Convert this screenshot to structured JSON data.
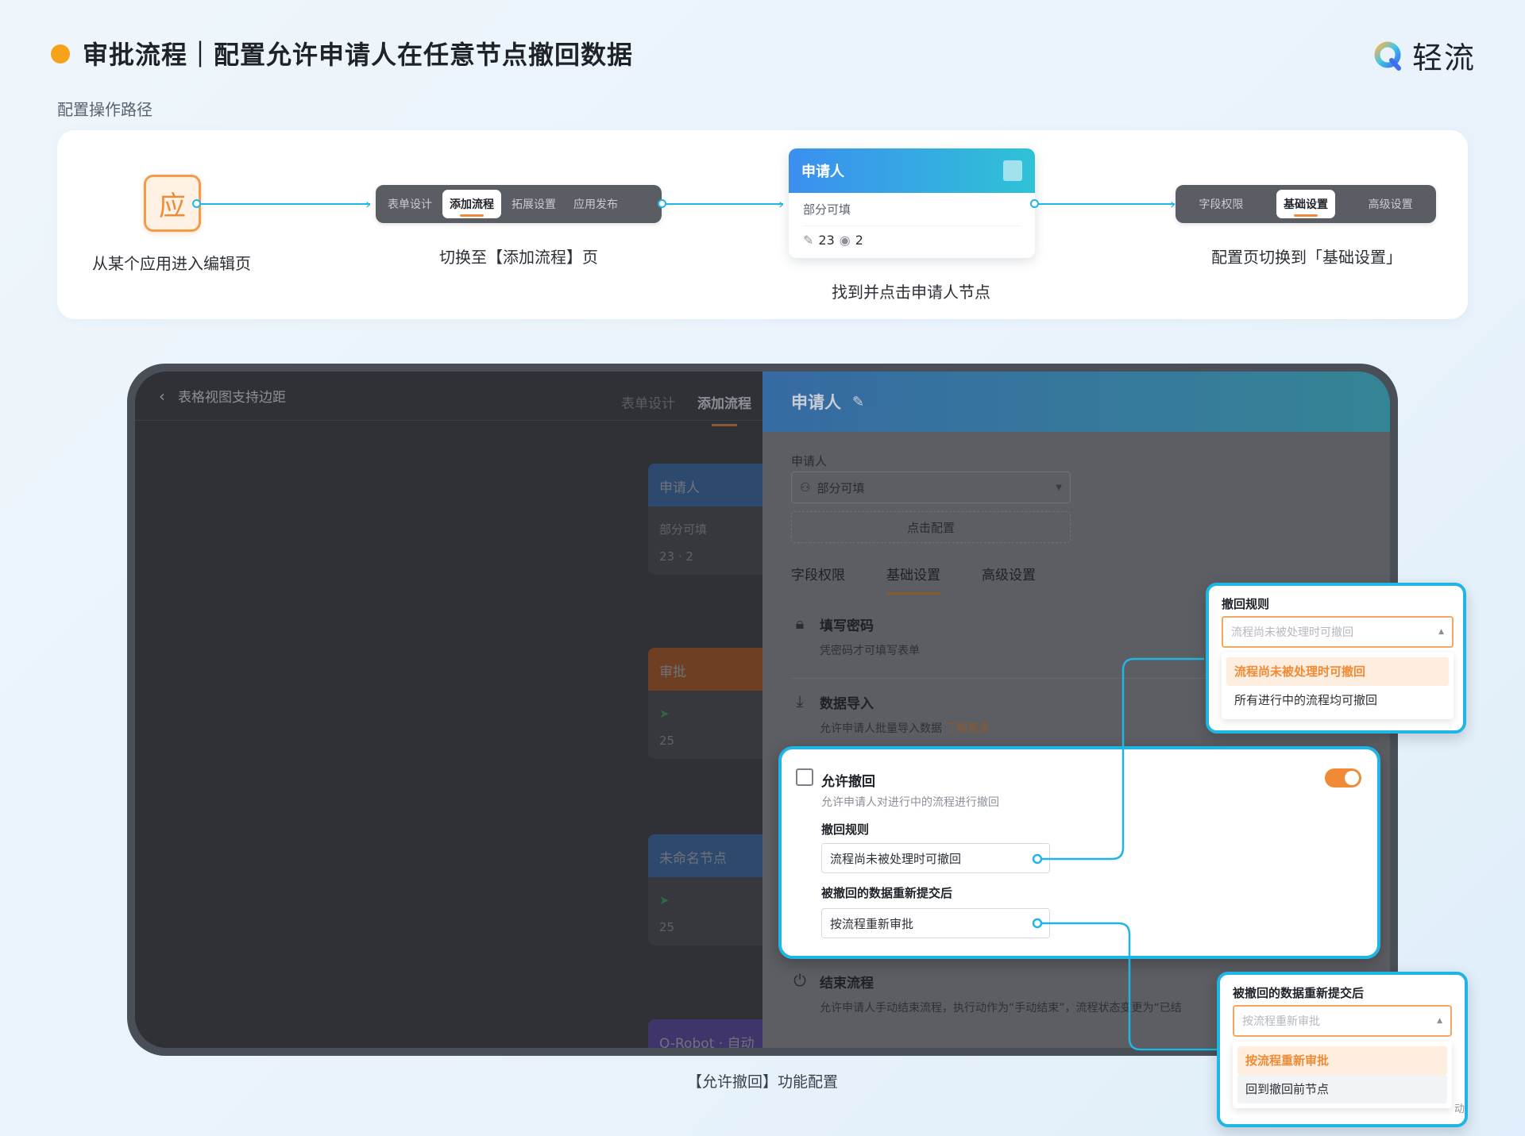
{
  "header": {
    "title": "审批流程｜配置允许申请人在任意节点撤回数据",
    "brand_name": "轻流",
    "path_label": "配置操作路径"
  },
  "steps": {
    "app_icon_char": "应",
    "step1_caption": "从某个应用进入编辑页",
    "step2_tabs": [
      "表单设计",
      "添加流程",
      "拓展设置",
      "应用发布"
    ],
    "step2_caption": "切换至【添加流程】页",
    "step3_node_title": "申请人",
    "step3_node_sub": "部分可填",
    "step3_edit_count": "23",
    "step3_view_count": "2",
    "step3_caption": "找到并点击申请人节点",
    "step4_tabs": [
      "字段权限",
      "基础设置",
      "高级设置"
    ],
    "step4_caption": "配置页切换到「基础设置」"
  },
  "editor": {
    "back_title": "表格视图支持边距",
    "top_tabs": [
      "表单设计",
      "添加流程"
    ],
    "nodes": [
      {
        "title": "申请人",
        "sub": "部分可填",
        "stats": "23 · 2"
      },
      {
        "title": "审批",
        "sub": "",
        "stats": "25"
      },
      {
        "title": "未命名节点",
        "sub": "",
        "stats": "25"
      },
      {
        "title": "Q-Robot · 自动流",
        "sub": "",
        "stats": ""
      }
    ]
  },
  "panel": {
    "title": "申请人",
    "field_label": "申请人",
    "select_value": "部分可填",
    "config_button": "点击配置",
    "tabs": [
      "字段权限",
      "基础设置",
      "高级设置"
    ],
    "items": [
      {
        "title": "填写密码",
        "desc": "凭密码才可填写表单"
      },
      {
        "title": "数据导入",
        "desc": "允许申请人批量导入数据",
        "link": "了解更多"
      },
      {
        "title": "结束流程",
        "desc": "允许申请人手动结束流程，执行动作为“手动结束”，流程状态变更为“已结"
      }
    ]
  },
  "withdraw": {
    "title": "允许撤回",
    "desc": "允许申请人对进行中的流程进行撤回",
    "rule_label": "撤回规则",
    "rule_value": "流程尚未被处理时可撤回",
    "resubmit_label": "被撤回的数据重新提交后",
    "resubmit_value": "按流程重新审批",
    "toggle_on": true
  },
  "popover_rule": {
    "title": "撤回规则",
    "placeholder": "流程尚未被处理时可撤回",
    "options": [
      "流程尚未被处理时可撤回",
      "所有进行中的流程均可撤回"
    ]
  },
  "popover_resubmit": {
    "title": "被撤回的数据重新提交后",
    "placeholder": "按流程重新审批",
    "options": [
      "按流程重新审批",
      "回到撤回前节点"
    ],
    "overflow_text": "动"
  },
  "footer": {
    "caption": "【允许撤回】功能配置"
  },
  "colors": {
    "accent_orange": "#f08a34",
    "highlight_cyan": "#1fb6e6",
    "node_gradient_start": "#3b8ff0",
    "node_gradient_end": "#2fc2d6"
  }
}
